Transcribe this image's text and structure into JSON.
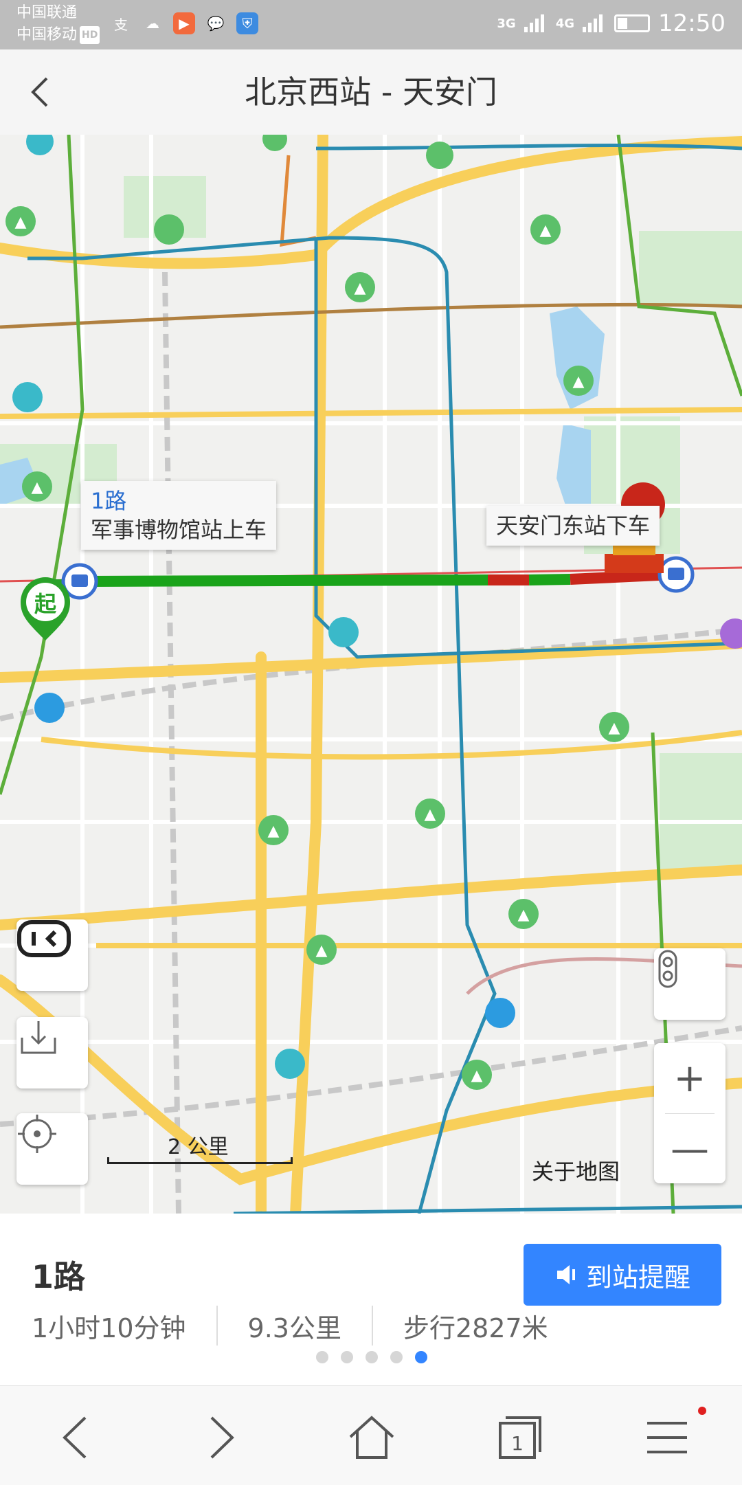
{
  "status_bar": {
    "carrier1": "中国联通",
    "carrier2": "中国移动",
    "carrier2_badge": "HD",
    "signal1": "3G",
    "signal2": "4G",
    "time": "12:50"
  },
  "header": {
    "title": "北京西站 - 天安门"
  },
  "map": {
    "boarding_callout": {
      "route": "1路",
      "text": "军事博物馆站上车"
    },
    "alight_callout": {
      "text": "天安门东站下车"
    },
    "start_marker": "起",
    "scale_label": "2 公里",
    "about_link": "关于地图",
    "zoom_in": "+",
    "zoom_out": "—"
  },
  "card": {
    "route_name": "1路",
    "remind_button": "到站提醒",
    "duration": "1小时10分钟",
    "distance": "9.3公里",
    "walk": "步行2827米",
    "page_dots_total": 5,
    "page_dots_active": 5
  },
  "navbar": {
    "tab_count": "1"
  },
  "colors": {
    "accent": "#3385ff",
    "route_green": "#1aa31a",
    "route_red": "#c8261a",
    "road_yellow": "#f8cf5a",
    "subway_blue": "#2a8cb0"
  }
}
